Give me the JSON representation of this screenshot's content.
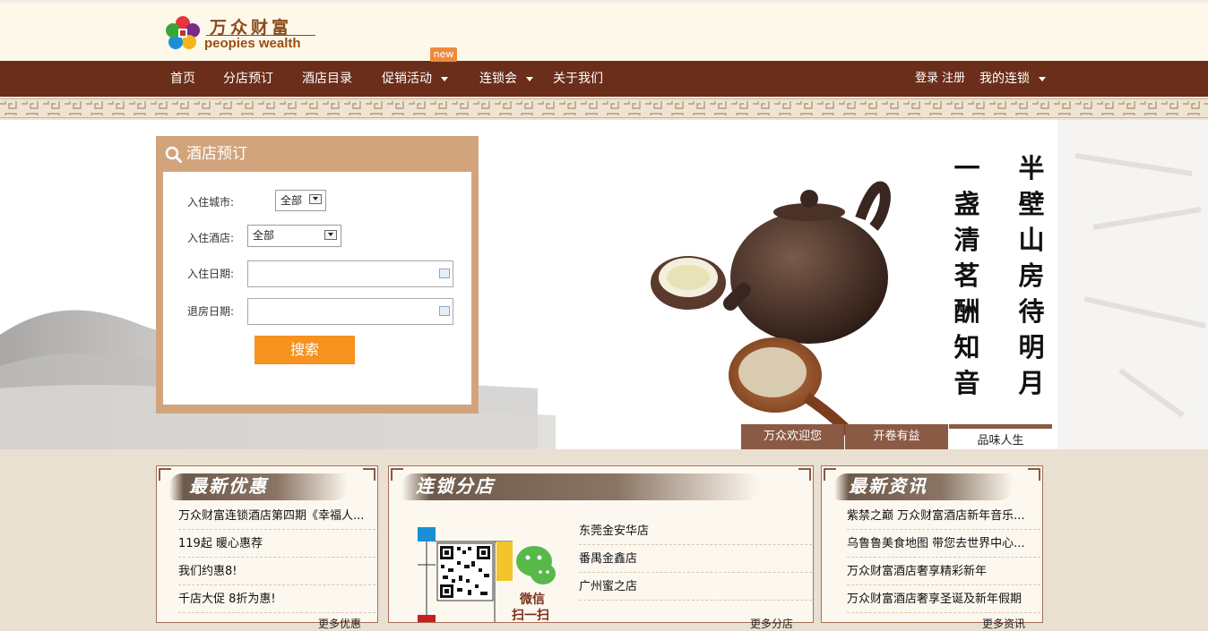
{
  "logo": {
    "cn": "万众财富",
    "en": "peopies wealth"
  },
  "nav": {
    "items": [
      "首页",
      "分店预订",
      "酒店目录",
      "促销活动",
      "连锁会",
      "关于我们"
    ],
    "badge": "new",
    "login": "登录",
    "register": "注册",
    "my_chain": "我的连锁"
  },
  "booking": {
    "title": "酒店预订",
    "city_label": "入住城市:",
    "city_value": "全部",
    "hotel_label": "入住酒店:",
    "hotel_value": "全部",
    "checkin_label": "入住日期:",
    "checkout_label": "退房日期:",
    "search_button": "搜索"
  },
  "banner": {
    "poem_right": [
      "半",
      "壁",
      "山",
      "房",
      "待",
      "明",
      "月"
    ],
    "poem_left": [
      "一",
      "盏",
      "清",
      "茗",
      "酬",
      "知",
      "音"
    ],
    "tabs": [
      "万众欢迎您",
      "开卷有益",
      "品味人生"
    ],
    "active_tab": 2
  },
  "panels": {
    "promo": {
      "title": "最新优惠",
      "items": [
        "万众财富连锁酒店第四期《幸福人...",
        "119起 暖心惠荐",
        "我们约惠8!",
        "千店大促 8折为惠!"
      ],
      "more": "更多优惠"
    },
    "branches": {
      "title": "连锁分店",
      "wechat_text_1": "微信",
      "wechat_text_2": "扫一扫",
      "items": [
        "东莞金安华店",
        "番禺金鑫店",
        "广州蜜之店"
      ],
      "more": "更多分店"
    },
    "news": {
      "title": "最新资讯",
      "items": [
        "紫禁之巅 万众财富酒店新年音乐...",
        "乌鲁鲁美食地图 带您去世界中心...",
        "万众财富酒店奢享精彩新年",
        "万众财富酒店奢享圣诞及新年假期"
      ],
      "more": "更多资讯"
    }
  },
  "colors": {
    "nav_bg": "#6b2e1a",
    "booking_frame": "#d2a47c",
    "search_btn": "#f7921e"
  }
}
